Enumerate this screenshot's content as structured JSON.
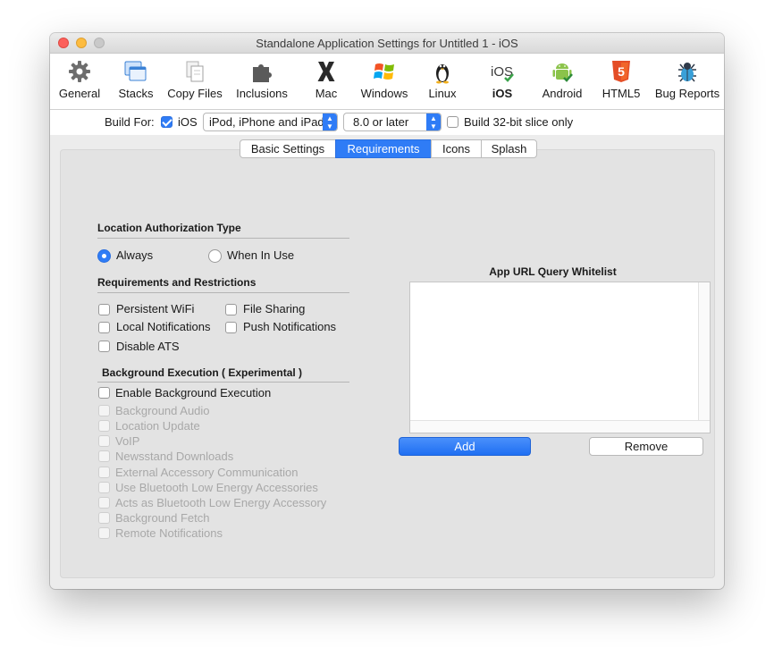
{
  "window": {
    "title": "Standalone Application Settings for Untitled 1 - iOS"
  },
  "toolbar": {
    "items": [
      {
        "label": "General",
        "icon": "gear-icon"
      },
      {
        "label": "Stacks",
        "icon": "stacks-icon"
      },
      {
        "label": "Copy Files",
        "icon": "copy-files-icon"
      },
      {
        "label": "Inclusions",
        "icon": "puzzle-icon"
      },
      {
        "label": "Mac",
        "icon": "mac-x-icon"
      },
      {
        "label": "Windows",
        "icon": "windows-icon"
      },
      {
        "label": "Linux",
        "icon": "linux-penguin-icon"
      },
      {
        "label": "iOS",
        "icon": "ios-icon"
      },
      {
        "label": "Android",
        "icon": "android-icon"
      },
      {
        "label": "HTML5",
        "icon": "html5-icon"
      },
      {
        "label": "Bug Reports",
        "icon": "bug-icon"
      }
    ],
    "active": "iOS"
  },
  "build": {
    "label": "Build For:",
    "ios_label": "iOS",
    "ios_checked": true,
    "device_value": "iPod, iPhone and iPad",
    "version_value": "8.0 or later",
    "slice_label": "Build 32-bit slice only",
    "slice_checked": false
  },
  "tabs": [
    {
      "label": "Basic Settings"
    },
    {
      "label": "Requirements"
    },
    {
      "label": "Icons"
    },
    {
      "label": "Splash"
    }
  ],
  "selected_tab": "Requirements",
  "location": {
    "title": "Location Authorization Type",
    "always": "Always",
    "when_in_use": "When In Use",
    "selected": "Always"
  },
  "requirements": {
    "title": "Requirements and Restrictions",
    "persistent_wifi": "Persistent WiFi",
    "file_sharing": "File Sharing",
    "local_notifications": "Local Notifications",
    "push_notifications": "Push Notifications",
    "disable_ats": "Disable ATS"
  },
  "background": {
    "title": "Background Execution ( Experimental )",
    "enable": "Enable Background Execution",
    "options": [
      "Background Audio",
      "Location Update",
      "VoIP",
      "Newsstand Downloads",
      "External Accessory Communication",
      "Use Bluetooth Low Energy Accessories",
      "Acts as Bluetooth Low Energy Accessory",
      "Background Fetch",
      "Remote Notifications"
    ]
  },
  "whitelist": {
    "title": "App URL Query Whitelist",
    "add": "Add",
    "remove": "Remove"
  },
  "colors": {
    "accent": "#2f7cf6"
  }
}
